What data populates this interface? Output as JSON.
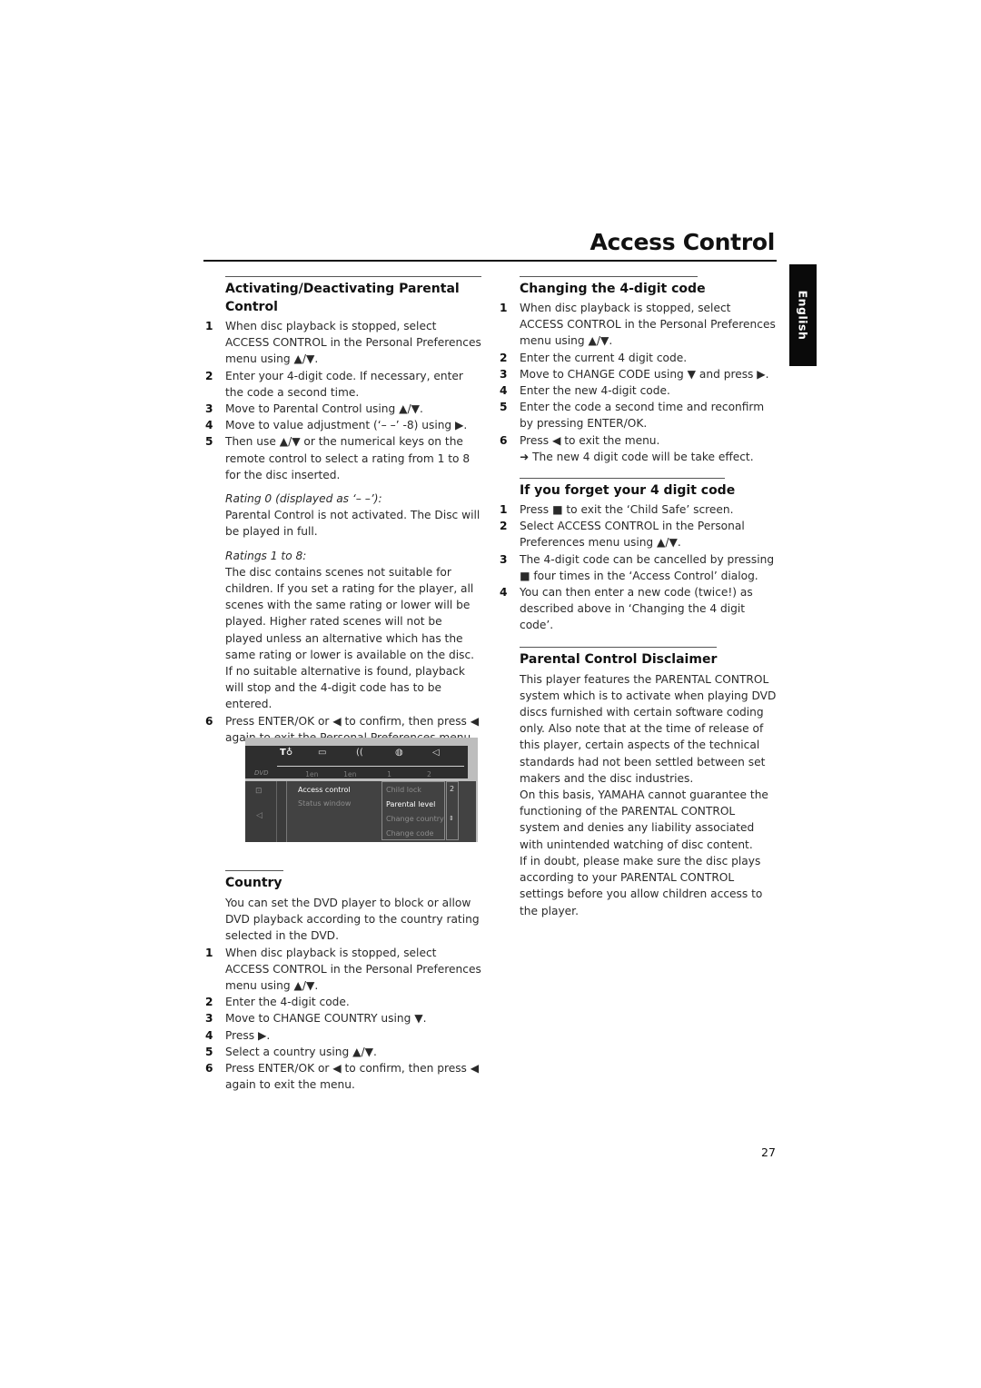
{
  "page": {
    "title": "Access Control",
    "language_tab": "English",
    "page_number": "27"
  },
  "left_column": {
    "activating": {
      "heading": "Activating/Deactivating Parental Control",
      "steps": [
        {
          "num": "1",
          "text": "When disc playback is stopped, select ACCESS CONTROL in the Personal Preferences menu using ▲/▼."
        },
        {
          "num": "2",
          "text": "Enter your 4-digit code. If necessary, enter the code a second time."
        },
        {
          "num": "3",
          "text": "Move to Parental Control using ▲/▼."
        },
        {
          "num": "4",
          "text": "Move to value adjustment (‘– –’ -8) using ▶."
        },
        {
          "num": "5",
          "text": "Then use ▲/▼ or the numerical keys on the remote control to select a rating from 1 to 8 for the disc inserted."
        }
      ],
      "rating0_label": "Rating 0 (displayed as ‘– –’):",
      "rating0_text": "Parental Control is not activated. The Disc will be played in full.",
      "ratings_label": "Ratings 1 to 8:",
      "ratings_text": "The disc contains scenes not suitable for children. If you set a rating for the player, all scenes with the same rating or lower will be played. Higher rated scenes will not be played unless an alternative which has the same rating or lower is available on the disc. If no suitable alternative is found, playback will stop and the 4-digit code has to be entered.",
      "step6": {
        "num": "6",
        "text": "Press ENTER/OK or ◀ to confirm, then press ◀ again to exit the Personal Preferences menu."
      }
    },
    "osd": {
      "top_icons": [
        "T♁",
        "▭",
        "((",
        "◍",
        "◁"
      ],
      "values": [
        "1en",
        "1en",
        "1",
        "2"
      ],
      "menu_left": [
        "Access control",
        "Status window"
      ],
      "menu_right": [
        "Child lock",
        "Parental level",
        "Change country",
        "Change code"
      ],
      "level_value": "2",
      "selected_left": "Access control",
      "selected_right": "Parental level"
    },
    "country": {
      "heading": "Country",
      "intro": "You can set the DVD player to block or allow DVD playback according to the country rating selected in the DVD.",
      "steps": [
        {
          "num": "1",
          "text": "When disc playback is stopped, select ACCESS CONTROL in the Personal Preferences menu using ▲/▼."
        },
        {
          "num": "2",
          "text": "Enter the 4-digit code."
        },
        {
          "num": "3",
          "text": "Move to CHANGE COUNTRY using ▼."
        },
        {
          "num": "4",
          "text": "Press ▶."
        },
        {
          "num": "5",
          "text": "Select a country using ▲/▼."
        },
        {
          "num": "6",
          "text": "Press ENTER/OK or ◀ to confirm, then press ◀ again to exit the menu."
        }
      ]
    }
  },
  "right_column": {
    "change_code": {
      "heading": "Changing the 4-digit code",
      "steps": [
        {
          "num": "1",
          "text": "When disc playback is stopped, select ACCESS CONTROL in the Personal Preferences menu using ▲/▼."
        },
        {
          "num": "2",
          "text": "Enter the current 4 digit code."
        },
        {
          "num": "3",
          "text": "Move to CHANGE CODE using ▼ and press ▶."
        },
        {
          "num": "4",
          "text": "Enter the new 4-digit code."
        },
        {
          "num": "5",
          "text": "Enter the code a second time and reconfirm by pressing ENTER/OK."
        },
        {
          "num": "6",
          "text": "Press ◀ to exit the menu."
        }
      ],
      "result": "➜  The new 4 digit code will be take effect."
    },
    "forget": {
      "heading": "If you forget your 4 digit code",
      "steps": [
        {
          "num": "1",
          "text": "Press ■ to exit the ‘Child Safe’ screen."
        },
        {
          "num": "2",
          "text": "Select ACCESS CONTROL in the Personal Preferences menu using ▲/▼."
        },
        {
          "num": "3",
          "text": "The 4-digit code can be cancelled by pressing ■ four times in the ‘Access Control’ dialog."
        },
        {
          "num": "4",
          "text": "You can then enter a new code (twice!) as described above in ‘Changing the 4 digit code’."
        }
      ]
    },
    "disclaimer": {
      "heading": "Parental Control Disclaimer",
      "paragraphs": [
        "This player features the PARENTAL CONTROL system which is to activate when playing DVD discs furnished with certain software coding only. Also note that at the time of release of this player, certain aspects of the technical standards had not been settled between set makers and the disc industries.",
        "On this basis, YAMAHA cannot guarantee the functioning of the PARENTAL CONTROL system and denies any liability associated with unintended watching of disc content.",
        "If in doubt, please make sure the disc plays according to your PARENTAL CONTROL settings before you allow children access to the player."
      ]
    }
  }
}
